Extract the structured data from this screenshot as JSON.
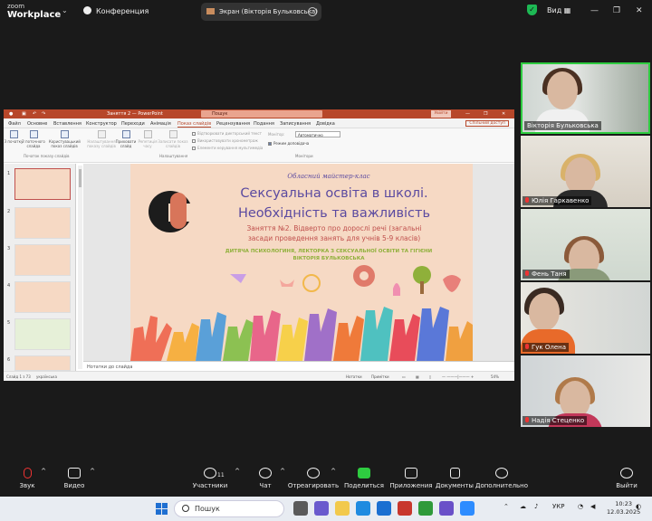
{
  "zoom": {
    "logo_top": "zoom",
    "logo_bottom": "Workplace",
    "meeting_label": "Конференция",
    "screen_share_label": "Экран (Вікторія Бульковська)",
    "view_label": "Вид"
  },
  "ppt": {
    "window_title": "Заняття 2  —  PowerPoint",
    "search_placeholder": "Пошук",
    "sign_in": "Увійти",
    "menu": [
      "Файл",
      "Основне",
      "Вставлення",
      "Конструктор",
      "Переходи",
      "Анімація",
      "Показ слайдів",
      "Рецензування",
      "Подання",
      "Записування",
      "Довідка"
    ],
    "share": "Спільний доступ",
    "ribbon": {
      "b1": "З початку",
      "b2": "З поточного слайда",
      "b3": "Користувацький показ слайдів",
      "b4": "Налаштування показу слайдів",
      "b5": "Приховати слайд",
      "b6": "Репетиція часу",
      "b7": "Записати показ слайдів",
      "g1": "Початок показу слайдів",
      "g2": "Налаштування",
      "g3": "Монітори",
      "c1": "Відтворювати дикторський текст",
      "c2": "Використовувати хронометраж",
      "c3": "Елементи керування мультимедіа",
      "monitor_label": "Монітор:",
      "monitor_value": "Автоматично",
      "presenter": "Режим доповідача"
    },
    "notes": "Нотатки до слайда",
    "status": {
      "slide": "Слайд 1 з 73",
      "lang": "українська",
      "notes_btn": "Нотатки",
      "comments_btn": "Примітки",
      "zoom": "54%"
    },
    "slide_numbers": [
      "1",
      "2",
      "3",
      "4",
      "5",
      "6"
    ],
    "slide": {
      "top": "Обласний майстер-клас",
      "title_line1": "Сексуальна освіта в школі.",
      "title_line2": "Необхідність та важливість",
      "sub_line1": "Заняття №2. Відверто про дорослі речі (загальні",
      "sub_line2": "засади проведення занять для учнів 5-9 класів)",
      "author_line1": "ДИТЯЧА ПСИХОЛОГИНЯ, ЛЕКТОРКА З СЕКСУАЛЬНОЇ ОСВІТИ ТА ГІГІЄНИ",
      "author_line2": "ВІКТОРІЯ БУЛЬКОВСЬКА"
    }
  },
  "participants": [
    "Вікторія Бульковська",
    "Юлія Гаркавенко",
    "Фень Таня",
    "Гук Олена",
    "Надія Стеценко"
  ],
  "toolbar": {
    "audio": "Звук",
    "video": "Видео",
    "participants": "Участники",
    "participants_count": "11",
    "chat": "Чат",
    "react": "Отреагировать",
    "share": "Поделиться",
    "apps": "Приложения",
    "docs": "Документы",
    "more": "Дополнительно",
    "exit": "Выйти"
  },
  "taskbar": {
    "search": "Пошук",
    "lang": "УКР",
    "time": "10:23",
    "date": "12.03.2025"
  }
}
